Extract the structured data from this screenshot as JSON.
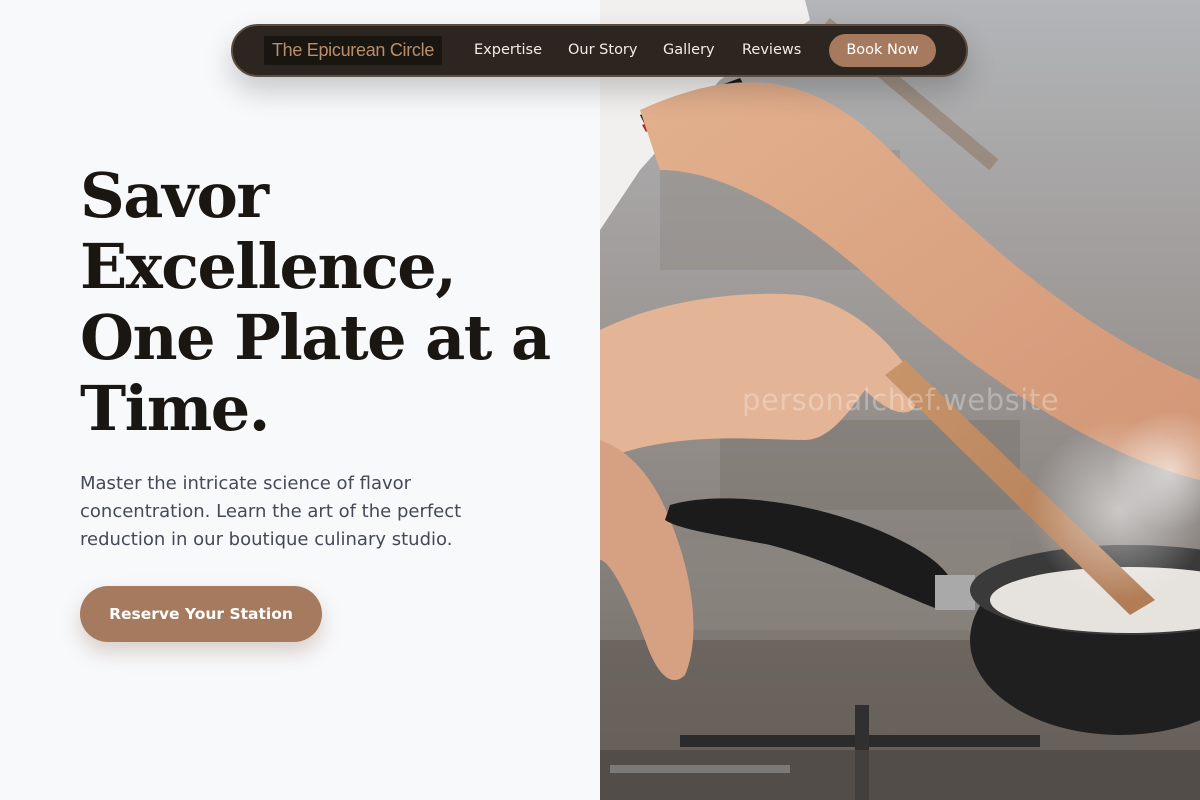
{
  "nav": {
    "brand": "The Epicurean Circle",
    "links": [
      "Expertise",
      "Our Story",
      "Gallery",
      "Reviews"
    ],
    "cta": "Book Now"
  },
  "hero": {
    "headline": "Savor Excellence, One Plate at a Time.",
    "subtext": "Master the intricate science of flavor concentration. Learn the art of the perfect reduction in our boutique culinary studio.",
    "cta": "Reserve Your Station"
  },
  "photo": {
    "watermark": "personalchef.website"
  },
  "colors": {
    "accent": "#a57a5e",
    "nav_background": "#2c2520",
    "brand_text": "#b98e6d",
    "headline": "#1a1612",
    "background": "#f8f9fb"
  }
}
